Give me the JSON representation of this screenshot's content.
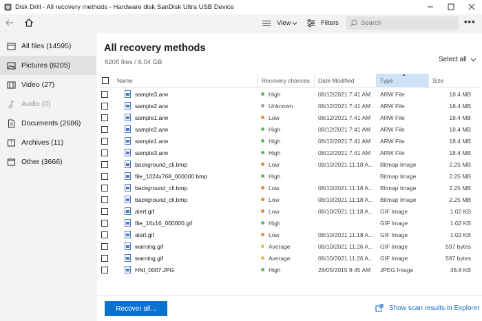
{
  "window": {
    "title": "Disk Drill - All recovery methods - Hardware disk SanDisk Ultra USB Device"
  },
  "toolbar": {
    "view_label": "View",
    "filters_label": "Filters",
    "search_placeholder": "Search",
    "more_label": "•••"
  },
  "sidebar": {
    "items": [
      {
        "label": "All files (14595)",
        "icon": "files-icon"
      },
      {
        "label": "Pictures (8205)",
        "icon": "picture-icon"
      },
      {
        "label": "Video (27)",
        "icon": "video-icon"
      },
      {
        "label": "Audio (0)",
        "icon": "music-icon"
      },
      {
        "label": "Documents (2686)",
        "icon": "document-icon"
      },
      {
        "label": "Archives (11)",
        "icon": "archive-icon"
      },
      {
        "label": "Other (3666)",
        "icon": "other-icon"
      }
    ]
  },
  "main": {
    "title": "All recovery methods",
    "subtitle": "8205 files / 6.04 GB",
    "select_all": "Select all"
  },
  "table": {
    "columns": [
      "Name",
      "Recovery chances",
      "Date Modified",
      "Type",
      "Size"
    ],
    "rows": [
      {
        "name": "sample3.arw",
        "chance": "High",
        "date": "08/12/2021 7:41 AM",
        "type": "ARW File",
        "size": "18.4 MB"
      },
      {
        "name": "sample2.arw",
        "chance": "Unknown",
        "date": "08/12/2021 7:41 AM",
        "type": "ARW File",
        "size": "18.4 MB"
      },
      {
        "name": "sample1.arw",
        "chance": "Low",
        "date": "08/12/2021 7:41 AM",
        "type": "ARW File",
        "size": "18.4 MB"
      },
      {
        "name": "sample2.arw",
        "chance": "High",
        "date": "08/12/2021 7:41 AM",
        "type": "ARW File",
        "size": "18.4 MB"
      },
      {
        "name": "sample1.arw",
        "chance": "High",
        "date": "08/12/2021 7:41 AM",
        "type": "ARW File",
        "size": "18.4 MB"
      },
      {
        "name": "sample3.arw",
        "chance": "High",
        "date": "08/12/2021 7:41 AM",
        "type": "ARW File",
        "size": "18.4 MB"
      },
      {
        "name": "background_cli.bmp",
        "chance": "Low",
        "date": "08/10/2021 11:18 A...",
        "type": "Bitmap Image",
        "size": "2.25 MB"
      },
      {
        "name": "file_1024x768_000000.bmp",
        "chance": "High",
        "date": "",
        "type": "Bitmap Image",
        "size": "2.25 MB"
      },
      {
        "name": "background_cli.bmp",
        "chance": "Low",
        "date": "08/10/2021 11:18 A...",
        "type": "Bitmap Image",
        "size": "2.25 MB"
      },
      {
        "name": "background_cli.bmp",
        "chance": "Low",
        "date": "08/10/2021 11:18 A...",
        "type": "Bitmap Image",
        "size": "2.25 MB"
      },
      {
        "name": "alert.gif",
        "chance": "Low",
        "date": "08/10/2021 11:18 A...",
        "type": "GIF Image",
        "size": "1.02 KB"
      },
      {
        "name": "file_16x16_000000.gif",
        "chance": "High",
        "date": "",
        "type": "GIF Image",
        "size": "1.02 KB"
      },
      {
        "name": "alert.gif",
        "chance": "Low",
        "date": "08/10/2021 11:18 A...",
        "type": "GIF Image",
        "size": "1.02 KB"
      },
      {
        "name": "warning.gif",
        "chance": "Average",
        "date": "08/10/2021 11:26 A...",
        "type": "GIF Image",
        "size": "597 bytes"
      },
      {
        "name": "warning.gif",
        "chance": "Average",
        "date": "08/10/2021 11:26 A...",
        "type": "GIF Image",
        "size": "597 bytes"
      },
      {
        "name": "HNI_0007.JPG",
        "chance": "High",
        "date": "28/05/2015 9:45 AM",
        "type": "JPEG Image",
        "size": "38.8 KB"
      }
    ]
  },
  "chance_colors": {
    "High": "#5cb85c",
    "Low": "#e8892b",
    "Unknown": "#9a9a9a",
    "Average": "#e6c23a"
  },
  "footer": {
    "recover_label": "Recover all...",
    "scan_link_label": "Show scan results in Explorer"
  },
  "colors": {
    "accent": "#0a73d2",
    "sort_header": "#cfe3f8",
    "link": "#1a6fc4"
  }
}
